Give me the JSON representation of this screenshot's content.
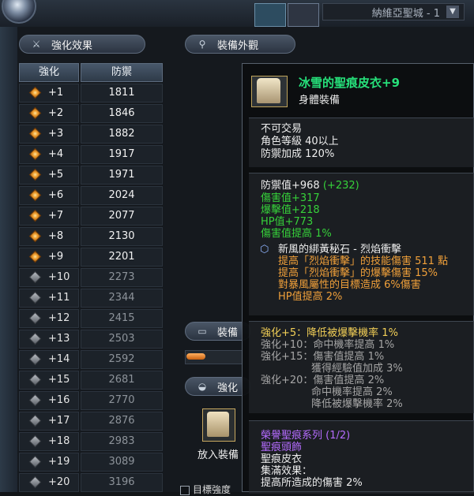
{
  "topbar": {
    "server": "納維亞聖城 - 1",
    "server_dropdown": "▼"
  },
  "panels": {
    "enhance_title": "強化效果",
    "look_title": "裝備外觀",
    "equip_title": "裝備",
    "strengthen_title": "強化",
    "place_label": "放入裝備",
    "target_label": "目標強度"
  },
  "table": {
    "col_enhance": "強化",
    "col_defense": "防禦",
    "rows": [
      {
        "level": "+1",
        "defense": "1811",
        "active": true
      },
      {
        "level": "+2",
        "defense": "1846",
        "active": true
      },
      {
        "level": "+3",
        "defense": "1882",
        "active": true
      },
      {
        "level": "+4",
        "defense": "1917",
        "active": true
      },
      {
        "level": "+5",
        "defense": "1971",
        "active": true
      },
      {
        "level": "+6",
        "defense": "2024",
        "active": true
      },
      {
        "level": "+7",
        "defense": "2077",
        "active": true
      },
      {
        "level": "+8",
        "defense": "2130",
        "active": true
      },
      {
        "level": "+9",
        "defense": "2201",
        "active": true
      },
      {
        "level": "+10",
        "defense": "2273",
        "active": false
      },
      {
        "level": "+11",
        "defense": "2344",
        "active": false
      },
      {
        "level": "+12",
        "defense": "2415",
        "active": false
      },
      {
        "level": "+13",
        "defense": "2503",
        "active": false
      },
      {
        "level": "+14",
        "defense": "2592",
        "active": false
      },
      {
        "level": "+15",
        "defense": "2681",
        "active": false
      },
      {
        "level": "+16",
        "defense": "2770",
        "active": false
      },
      {
        "level": "+17",
        "defense": "2876",
        "active": false
      },
      {
        "level": "+18",
        "defense": "2983",
        "active": false
      },
      {
        "level": "+19",
        "defense": "3089",
        "active": false
      },
      {
        "level": "+20",
        "defense": "3196",
        "active": false
      }
    ]
  },
  "tooltip": {
    "name": "冰雪的聖痕皮衣+9",
    "type": "身體裝備",
    "basic": [
      "不可交易",
      "角色等級 40以上",
      "防禦加成 120%"
    ],
    "defense_value": "防禦值+968",
    "defense_bonus": "(+232)",
    "stats": [
      "傷害值+317",
      "爆擊值+218",
      "HP值+773",
      "傷害值提高 1%"
    ],
    "gem_title": "新風的綁黃秘石 - 烈焰衝擊",
    "gem_lines": [
      "提高「烈焰衝擊」的技能傷害 511 點",
      "提高「烈焰衝擊」的爆擊傷害 15%",
      "對暴風屬性的目標造成 6%傷害",
      "HP值提高 2%"
    ],
    "enh_active": "強化+5：降低被爆擊機率 1%",
    "enh_lines": [
      "強化+10：命中機率提高 1%",
      "強化+15：傷害值提高 1%",
      "獲得經驗值加成 3%",
      "強化+20：傷害值提高 2%",
      "命中機率提高 2%",
      "降低被爆擊機率 2%"
    ],
    "set_title": "榮譽聖痕系列 (1/2)",
    "set_item1": "聖痕頭飾",
    "set_item2": "聖痕皮衣",
    "set_effect_label": "集滿效果：",
    "set_effect": "提高所造成的傷害 2%"
  },
  "colors": {
    "item_name": "#26e07a",
    "bonus_green": "#36d13a",
    "gem_orange": "#f0a03a",
    "enh_yellow": "#f2cf57",
    "set_purple": "#b56cff"
  },
  "icons": {
    "enhance": "sword-icon",
    "look": "magnifier-icon",
    "equip": "book-icon",
    "strengthen": "bag-icon",
    "gem": "hexagon-gem-icon"
  }
}
